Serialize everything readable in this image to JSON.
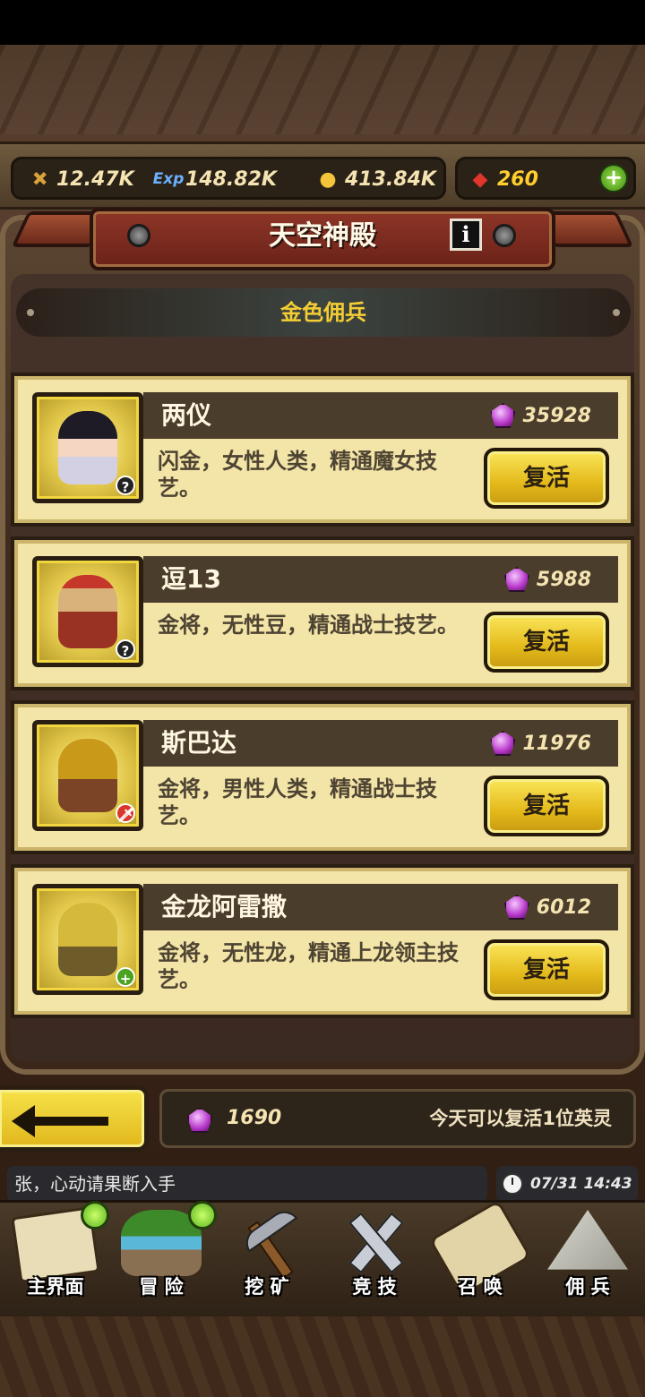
{
  "resources": {
    "attack": {
      "icon": "sword-icon",
      "value": "12.47K"
    },
    "exp": {
      "icon": "exp-icon",
      "label": "Exp",
      "value": "148.82K"
    },
    "gold": {
      "icon": "coin-icon",
      "value": "413.84K"
    },
    "ruby": {
      "icon": "ruby-icon",
      "value": "260"
    }
  },
  "header": {
    "title": "天空神殿",
    "info_label": "i"
  },
  "subtitle": "金色佣兵",
  "mercenaries": [
    {
      "name": "两仪",
      "cost": "35928",
      "desc": "闪金，女性人类，精通魔女技艺。",
      "badge": "?",
      "button": "复活"
    },
    {
      "name": "逗13",
      "cost": "5988",
      "desc": "金将，无性豆，精通战士技艺。",
      "badge": "?",
      "button": "复活"
    },
    {
      "name": "斯巴达",
      "cost": "11976",
      "desc": "金将，男性人类，精通战士技艺。",
      "badge": "🗡",
      "button": "复活"
    },
    {
      "name": "金龙阿雷撒",
      "cost": "6012",
      "desc": "金将，无性龙，精通上龙领主技艺。",
      "badge": "+",
      "button": "复活"
    }
  ],
  "footer": {
    "gems": "1690",
    "note": "今天可以复活1位英灵"
  },
  "chat": {
    "message": "张，心动请果断入手",
    "time": "07/31 14:43"
  },
  "nav": [
    {
      "label": "主界面",
      "icon": "map-icon"
    },
    {
      "label": "冒 险",
      "icon": "island-icon"
    },
    {
      "label": "挖 矿",
      "icon": "pickaxe-icon"
    },
    {
      "label": "竞 技",
      "icon": "crossed-swords-icon"
    },
    {
      "label": "召 唤",
      "icon": "scroll-icon"
    },
    {
      "label": "佣 兵",
      "icon": "tent-icon"
    }
  ],
  "colors": {
    "accent_gold": "#f3cd33",
    "card_bg": "#f3e4a7",
    "banner_red": "#8d3527"
  }
}
